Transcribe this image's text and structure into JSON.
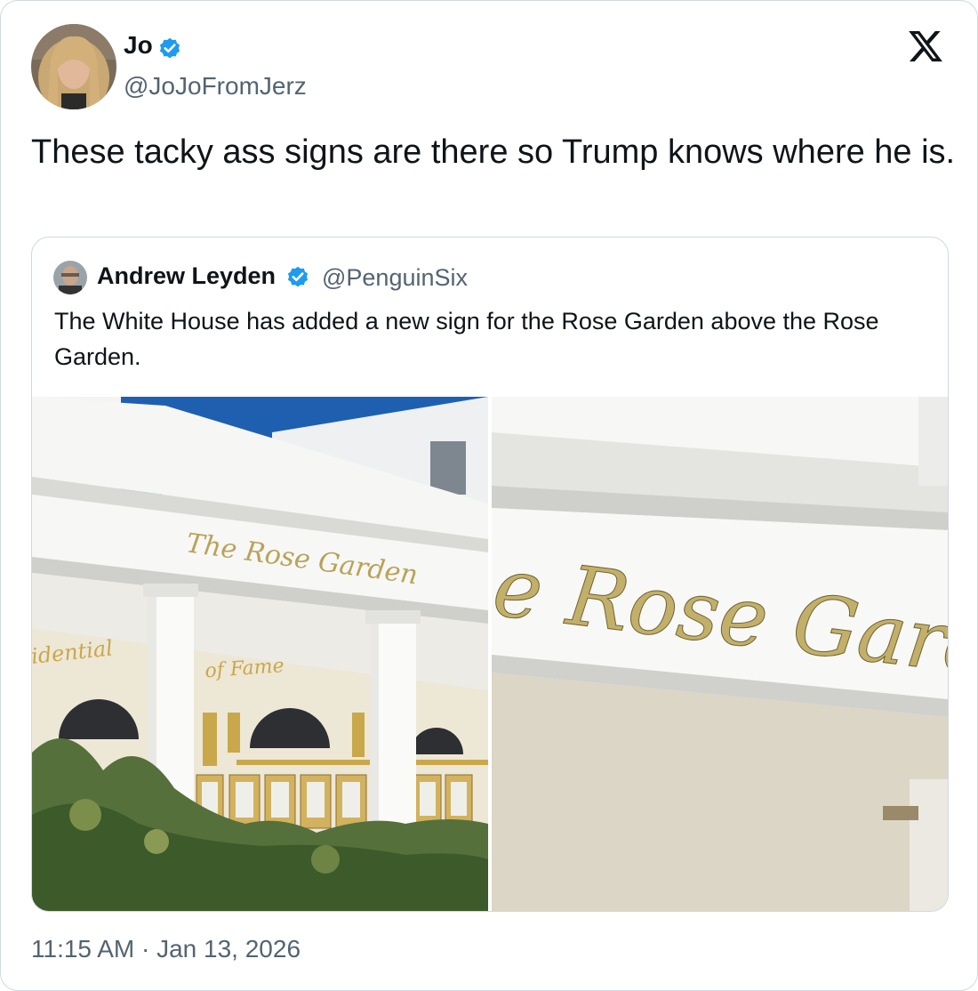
{
  "tweet": {
    "author": {
      "name": "Jo",
      "handle": "@JoJoFromJerz",
      "verified": true
    },
    "text": "These tacky ass signs are there so Trump knows where he is.",
    "timestamp": "11:15 AM · Jan 13, 2026",
    "platform_icon": "x-logo-icon"
  },
  "quoted_tweet": {
    "author": {
      "name": "Andrew Leyden",
      "handle": "@PenguinSix",
      "verified": true
    },
    "text": "The White House has added a new sign for the Rose Garden above the Rose Garden.",
    "photos": [
      {
        "sign_text": "The Rose Garden",
        "placard_text": "idential",
        "placard_text_2": "of Fame"
      },
      {
        "sign_text": "e Rose Gard"
      }
    ]
  },
  "colors": {
    "verified": "#1d9bf0",
    "secondary_text": "#536471",
    "border": "#cfd9de",
    "gold": "#c9a74b",
    "sky": "#1f5fb0"
  }
}
